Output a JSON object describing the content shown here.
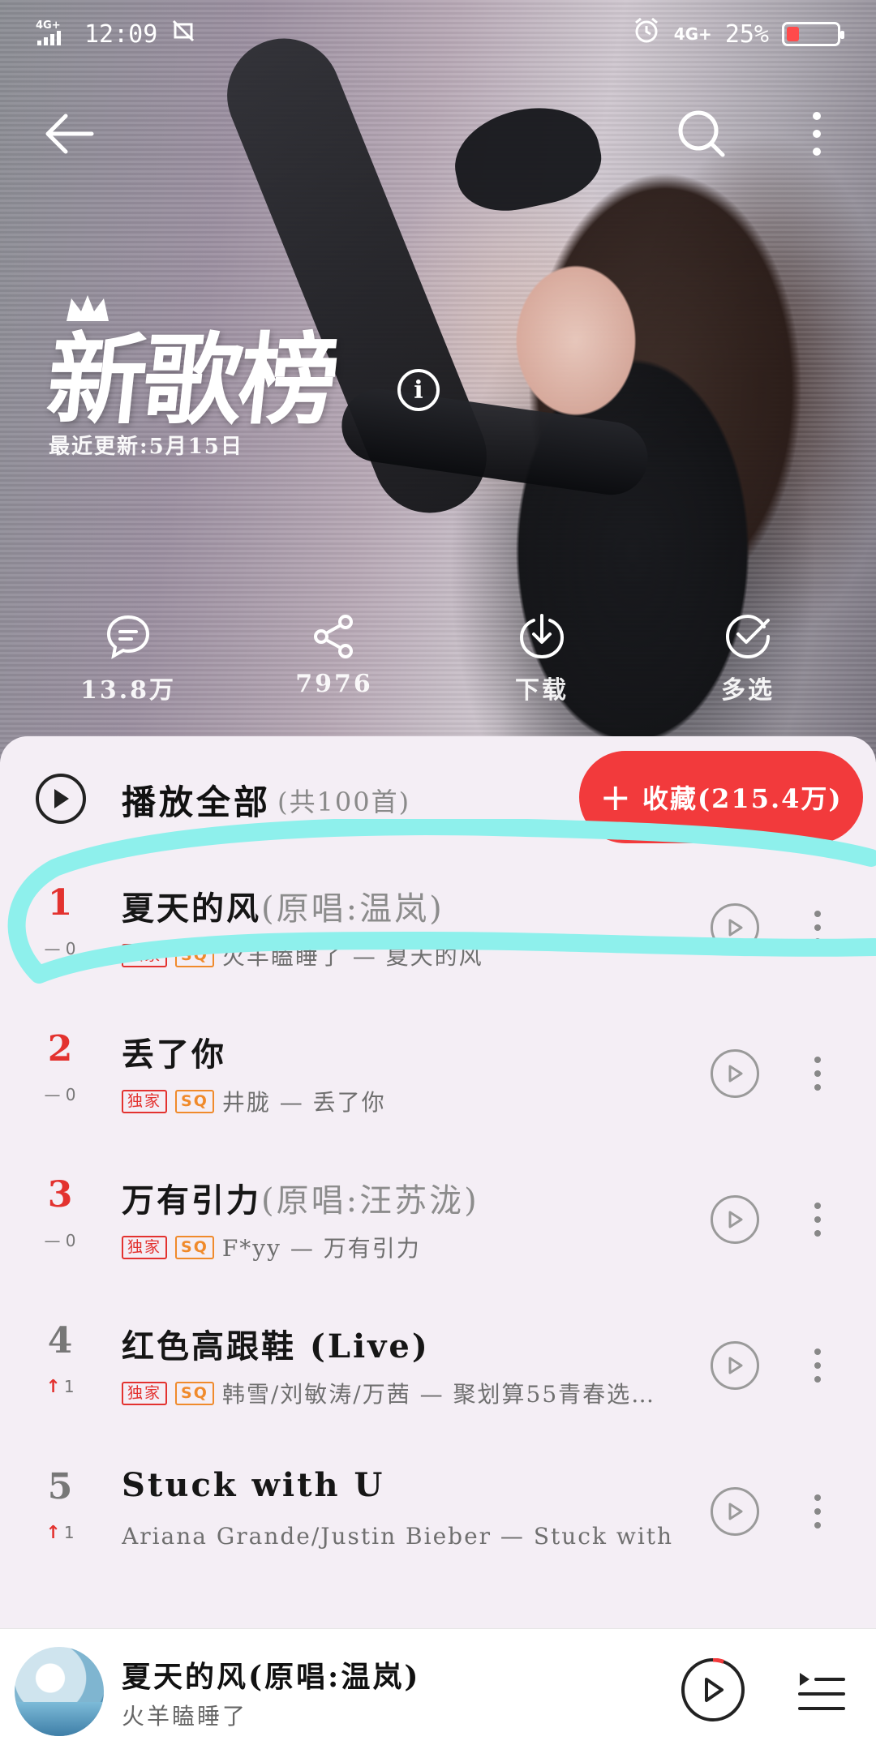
{
  "status_bar": {
    "network_left": "4G+",
    "time": "12:09",
    "network_right": "4G+",
    "battery_percent": "25%",
    "battery_level": 0.25
  },
  "chart": {
    "title": "新歌榜",
    "updated": "最近更新:5月15日"
  },
  "actions": {
    "comments": "13.8万",
    "share": "7976",
    "download": "下载",
    "multiselect": "多选"
  },
  "playall": {
    "label": "播放全部",
    "count": "(共100首)",
    "collect_label": "收藏(215.4万)"
  },
  "songs": [
    {
      "rank": "1",
      "trend": "— 0",
      "title": "夏天的风",
      "orig": "(原唱:温岚)",
      "tags": [
        "独家",
        "SQ"
      ],
      "sub": "火羊瞌睡了 — 夏天的风"
    },
    {
      "rank": "2",
      "trend": "— 0",
      "title": "丢了你",
      "orig": "",
      "tags": [
        "独家",
        "SQ"
      ],
      "sub": "井胧 — 丢了你"
    },
    {
      "rank": "3",
      "trend": "— 0",
      "title": "万有引力",
      "orig": "(原唱:汪苏泷)",
      "tags": [
        "独家",
        "SQ"
      ],
      "sub": "F*yy — 万有引力"
    },
    {
      "rank": "4",
      "trend": "1",
      "title": "红色高跟鞋 (Live)",
      "orig": "",
      "tags": [
        "独家",
        "SQ"
      ],
      "sub": "韩雪/刘敏涛/万茜 — 聚划算55青春选…"
    },
    {
      "rank": "5",
      "trend": "1",
      "title": "Stuck with U",
      "orig": "",
      "tags": [],
      "sub": "Ariana Grande/Justin Bieber — Stuck with U"
    }
  ],
  "now_playing": {
    "title": "夏天的风(原唱:温岚)",
    "artist": "火羊瞌睡了"
  },
  "colors": {
    "accent_red": "#f23a3c",
    "highlight_cyan": "#8ef0ec"
  }
}
